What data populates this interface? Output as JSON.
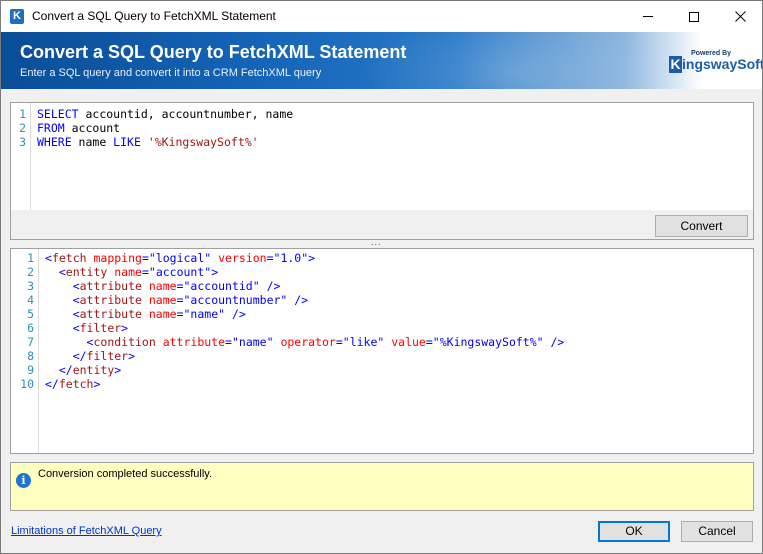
{
  "window": {
    "title": "Convert a SQL Query to FetchXML Statement",
    "app_icon": "K"
  },
  "banner": {
    "title": "Convert a SQL Query to FetchXML Statement",
    "subtitle": "Enter a SQL query and convert it into a CRM FetchXML query",
    "logo_powered": "Powered By",
    "logo_k": "K",
    "logo_name": "ingswaySoft"
  },
  "sql_editor": {
    "line_numbers": [
      "1",
      "2",
      "3"
    ],
    "lines": [
      [
        {
          "t": "SELECT",
          "c": "kw"
        },
        {
          "t": " accountid, accountnumber, name",
          "c": "txt"
        }
      ],
      [
        {
          "t": "FROM",
          "c": "kw"
        },
        {
          "t": " account",
          "c": "txt"
        }
      ],
      [
        {
          "t": "WHERE",
          "c": "kw"
        },
        {
          "t": " name ",
          "c": "txt"
        },
        {
          "t": "LIKE",
          "c": "kw"
        },
        {
          "t": " ",
          "c": "txt"
        },
        {
          "t": "'%KingswaySoft%'",
          "c": "str"
        }
      ]
    ]
  },
  "convert_button": "Convert",
  "splitter_glyph": "...",
  "xml_editor": {
    "line_numbers": [
      "1",
      "2",
      "3",
      "4",
      "5",
      "6",
      "7",
      "8",
      "9",
      "10"
    ],
    "lines": [
      [
        {
          "t": "<",
          "c": "punct"
        },
        {
          "t": "fetch",
          "c": "tag"
        },
        {
          "t": " mapping",
          "c": "attr"
        },
        {
          "t": "=",
          "c": "punct"
        },
        {
          "t": "\"logical\"",
          "c": "val"
        },
        {
          "t": " version",
          "c": "attr"
        },
        {
          "t": "=",
          "c": "punct"
        },
        {
          "t": "\"1.0\"",
          "c": "val"
        },
        {
          "t": ">",
          "c": "punct"
        }
      ],
      [
        {
          "t": "  <",
          "c": "punct"
        },
        {
          "t": "entity",
          "c": "tag"
        },
        {
          "t": " name",
          "c": "attr"
        },
        {
          "t": "=",
          "c": "punct"
        },
        {
          "t": "\"account\"",
          "c": "val"
        },
        {
          "t": ">",
          "c": "punct"
        }
      ],
      [
        {
          "t": "    <",
          "c": "punct"
        },
        {
          "t": "attribute",
          "c": "tag"
        },
        {
          "t": " name",
          "c": "attr"
        },
        {
          "t": "=",
          "c": "punct"
        },
        {
          "t": "\"accountid\"",
          "c": "val"
        },
        {
          "t": " />",
          "c": "punct"
        }
      ],
      [
        {
          "t": "    <",
          "c": "punct"
        },
        {
          "t": "attribute",
          "c": "tag"
        },
        {
          "t": " name",
          "c": "attr"
        },
        {
          "t": "=",
          "c": "punct"
        },
        {
          "t": "\"accountnumber\"",
          "c": "val"
        },
        {
          "t": " />",
          "c": "punct"
        }
      ],
      [
        {
          "t": "    <",
          "c": "punct"
        },
        {
          "t": "attribute",
          "c": "tag"
        },
        {
          "t": " name",
          "c": "attr"
        },
        {
          "t": "=",
          "c": "punct"
        },
        {
          "t": "\"name\"",
          "c": "val"
        },
        {
          "t": " />",
          "c": "punct"
        }
      ],
      [
        {
          "t": "    <",
          "c": "punct"
        },
        {
          "t": "filter",
          "c": "tag"
        },
        {
          "t": ">",
          "c": "punct"
        }
      ],
      [
        {
          "t": "      <",
          "c": "punct"
        },
        {
          "t": "condition",
          "c": "tag"
        },
        {
          "t": " attribute",
          "c": "attr"
        },
        {
          "t": "=",
          "c": "punct"
        },
        {
          "t": "\"name\"",
          "c": "val"
        },
        {
          "t": " operator",
          "c": "attr"
        },
        {
          "t": "=",
          "c": "punct"
        },
        {
          "t": "\"like\"",
          "c": "val"
        },
        {
          "t": " value",
          "c": "attr"
        },
        {
          "t": "=",
          "c": "punct"
        },
        {
          "t": "\"%KingswaySoft%\"",
          "c": "val"
        },
        {
          "t": " />",
          "c": "punct"
        }
      ],
      [
        {
          "t": "    </",
          "c": "punct"
        },
        {
          "t": "filter",
          "c": "tag"
        },
        {
          "t": ">",
          "c": "punct"
        }
      ],
      [
        {
          "t": "  </",
          "c": "punct"
        },
        {
          "t": "entity",
          "c": "tag"
        },
        {
          "t": ">",
          "c": "punct"
        }
      ],
      [
        {
          "t": "</",
          "c": "punct"
        },
        {
          "t": "fetch",
          "c": "tag"
        },
        {
          "t": ">",
          "c": "punct"
        }
      ]
    ]
  },
  "status": {
    "icon": "i",
    "message": "Conversion completed successfully."
  },
  "footer": {
    "limits_link": "Limitations of FetchXML Query",
    "ok_button": "OK",
    "cancel_button": "Cancel"
  },
  "colors": {
    "banner_start": "#0a4d97",
    "status_background": "#ffffc2",
    "link": "#0033cc",
    "keyword": "#0000ff",
    "string": "#a31515",
    "attribute": "#ff0000"
  }
}
